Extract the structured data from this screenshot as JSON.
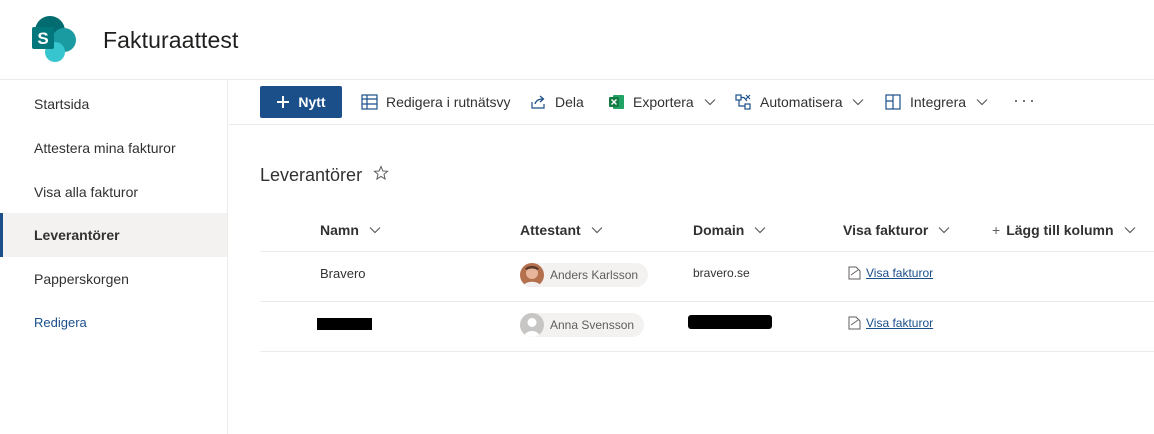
{
  "site": {
    "logo_letter": "S",
    "title": "Fakturaattest"
  },
  "nav": {
    "items": [
      {
        "label": "Startsida"
      },
      {
        "label": "Attestera mina fakturor"
      },
      {
        "label": "Visa alla fakturor"
      },
      {
        "label": "Leverantörer",
        "selected": true
      },
      {
        "label": "Papperskorgen"
      }
    ],
    "edit_label": "Redigera"
  },
  "commands": {
    "new_label": "Nytt",
    "grid_edit": "Redigera i rutnätsvy",
    "share": "Dela",
    "export": "Exportera",
    "automate": "Automatisera",
    "integrate": "Integrera",
    "more": "···"
  },
  "list": {
    "title": "Leverantörer",
    "columns": [
      "Namn",
      "Attestant",
      "Domain",
      "Visa fakturor",
      "Lägg till kolumn"
    ],
    "add_prefix": "+",
    "rows": [
      {
        "name": "Bravero",
        "attestant": "Anders Karlsson",
        "domain": "bravero.se",
        "link": "Visa fakturor"
      },
      {
        "name": "",
        "attestant": "Anna Svensson",
        "domain": "",
        "link": "Visa fakturor"
      }
    ]
  },
  "colors": {
    "accent": "#1b4f8a",
    "sharepoint_teal": "#036c70",
    "excel_green": "#107c41"
  },
  "icons": [
    "sharepoint-logo-icon",
    "plus-icon",
    "grid-icon",
    "share-icon",
    "excel-icon",
    "flow-icon",
    "integrate-icon",
    "star-icon",
    "chevron-down-icon",
    "document-icon"
  ]
}
